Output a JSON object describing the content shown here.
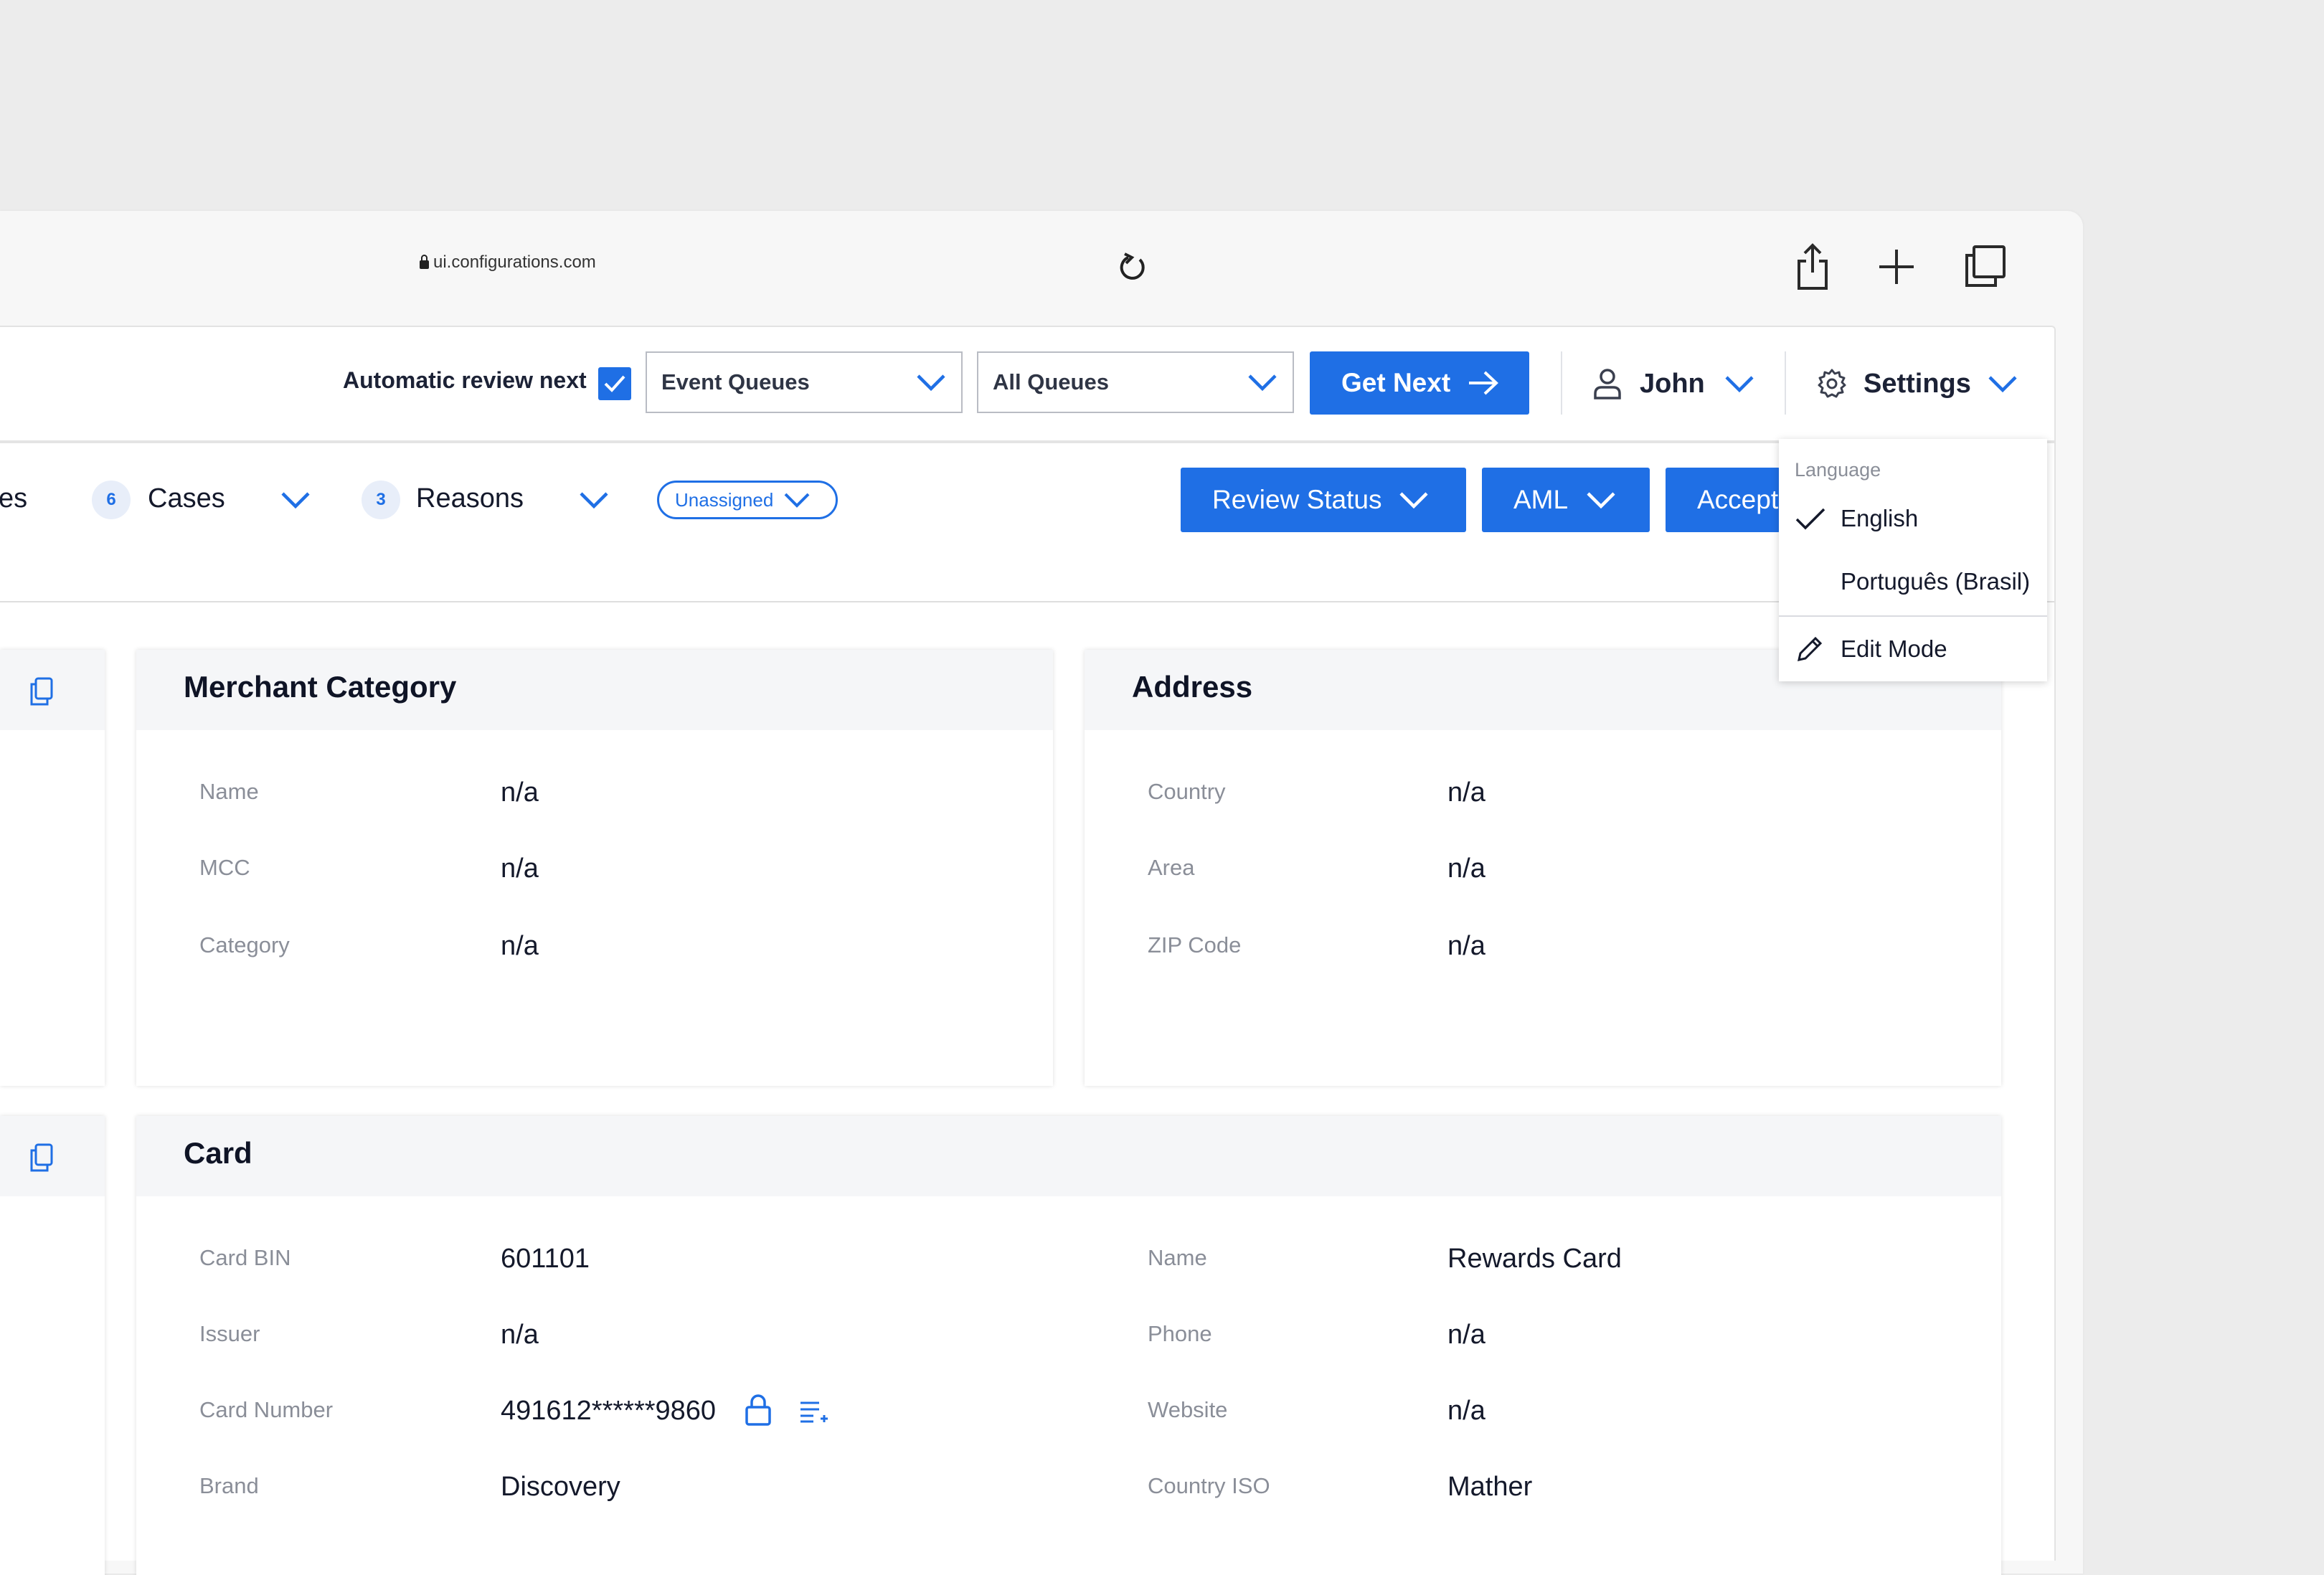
{
  "browser": {
    "url": "ui.configurations.com",
    "icons": [
      "lock-icon",
      "reload-icon",
      "share-icon",
      "new-tab-icon",
      "tabs-icon"
    ]
  },
  "topbar": {
    "auto_review_label": "Automatic review next",
    "auto_review_checked": true,
    "event_queues": "Event Queues",
    "all_queues": "All Queues",
    "get_next": "Get Next",
    "user": "John",
    "settings": "Settings"
  },
  "settings_menu": {
    "section_label": "Language",
    "options": [
      {
        "label": "English",
        "selected": true
      },
      {
        "label": "Português (Brasil)",
        "selected": false
      }
    ],
    "edit_mode": "Edit Mode"
  },
  "filters": {
    "partial_left": "es",
    "cases": {
      "count": "6",
      "label": "Cases"
    },
    "reasons": {
      "count": "3",
      "label": "Reasons"
    },
    "assignee_pill": "Unassigned",
    "review_status": "Review Status",
    "aml": "AML",
    "accept": "Accept"
  },
  "merchant_category": {
    "title": "Merchant Category",
    "rows": [
      {
        "label": "Name",
        "value": "n/a"
      },
      {
        "label": "MCC",
        "value": "n/a"
      },
      {
        "label": "Category",
        "value": "n/a"
      }
    ]
  },
  "address": {
    "title": "Address",
    "rows": [
      {
        "label": "Country",
        "value": "n/a"
      },
      {
        "label": "Area",
        "value": "n/a"
      },
      {
        "label": "ZIP Code",
        "value": "n/a"
      }
    ]
  },
  "card": {
    "title": "Card",
    "left_rows": [
      {
        "label": "Card BIN",
        "value": "601101"
      },
      {
        "label": "Issuer",
        "value": "n/a"
      },
      {
        "label": "Card Number",
        "value": "491612******9860"
      },
      {
        "label": "Brand",
        "value": "Discovery"
      }
    ],
    "right_rows": [
      {
        "label": "Name",
        "value": "Rewards Card"
      },
      {
        "label": "Phone",
        "value": "n/a"
      },
      {
        "label": "Website",
        "value": "n/a"
      },
      {
        "label": "Country ISO",
        "value": "Mather"
      }
    ]
  },
  "colors": {
    "accent": "#1f6fe5",
    "background": "#ececec",
    "panel_header": "#f5f6f8",
    "label_gray": "#8a8e98"
  }
}
